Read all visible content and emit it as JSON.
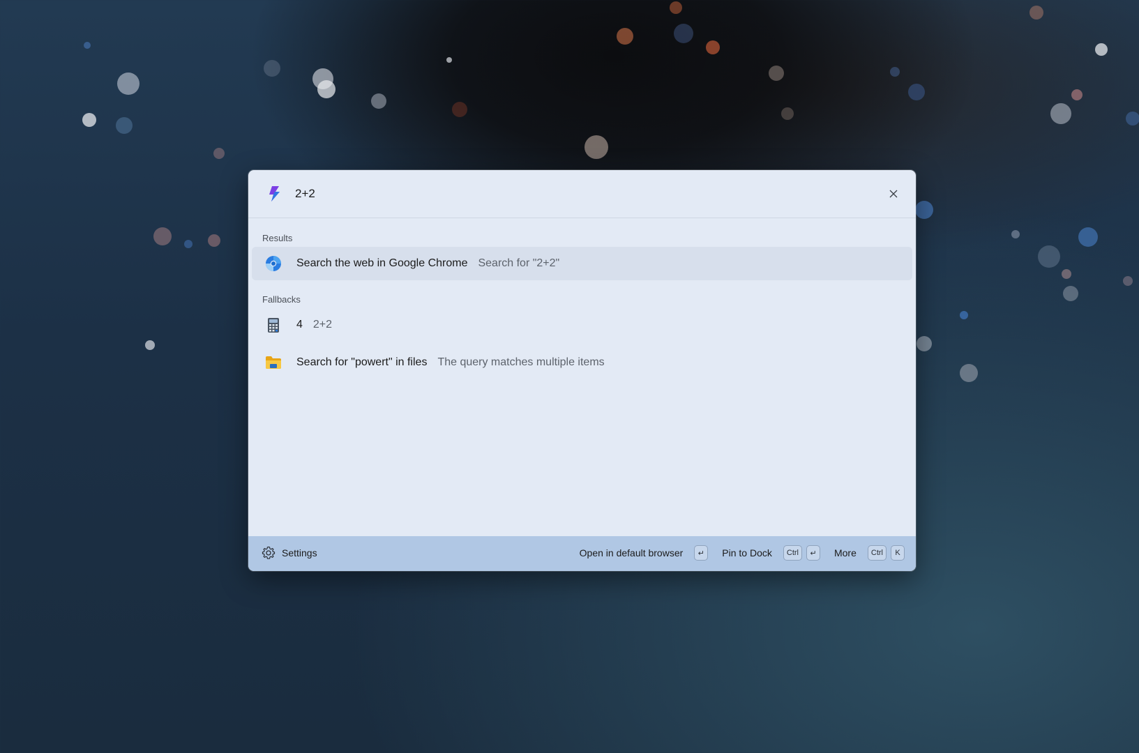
{
  "search": {
    "query": "2+2",
    "placeholder": ""
  },
  "sections": {
    "results_label": "Results",
    "fallbacks_label": "Fallbacks"
  },
  "results": [
    {
      "icon": "chrome-icon",
      "title": "Search the web in Google Chrome",
      "subtitle": "Search for \"2+2\""
    }
  ],
  "fallbacks": [
    {
      "icon": "calculator-icon",
      "title": "4",
      "subtitle": "2+2"
    },
    {
      "icon": "folder-icon",
      "title": "Search for \"powert\" in files",
      "subtitle": "The query matches multiple items"
    }
  ],
  "footer": {
    "settings_label": "Settings",
    "actions": [
      {
        "label": "Open in default browser",
        "keys": [
          "↵"
        ]
      },
      {
        "label": "Pin to Dock",
        "keys": [
          "Ctrl",
          "↵"
        ]
      },
      {
        "label": "More",
        "keys": [
          "Ctrl",
          "K"
        ]
      }
    ]
  },
  "colors": {
    "palette_bg": "#e3eaf5",
    "selected_row": "#d7dfec",
    "footer_bg": "#b0c7e4",
    "accent_purple": "#7b3fe4",
    "accent_blue": "#2a7de1"
  }
}
